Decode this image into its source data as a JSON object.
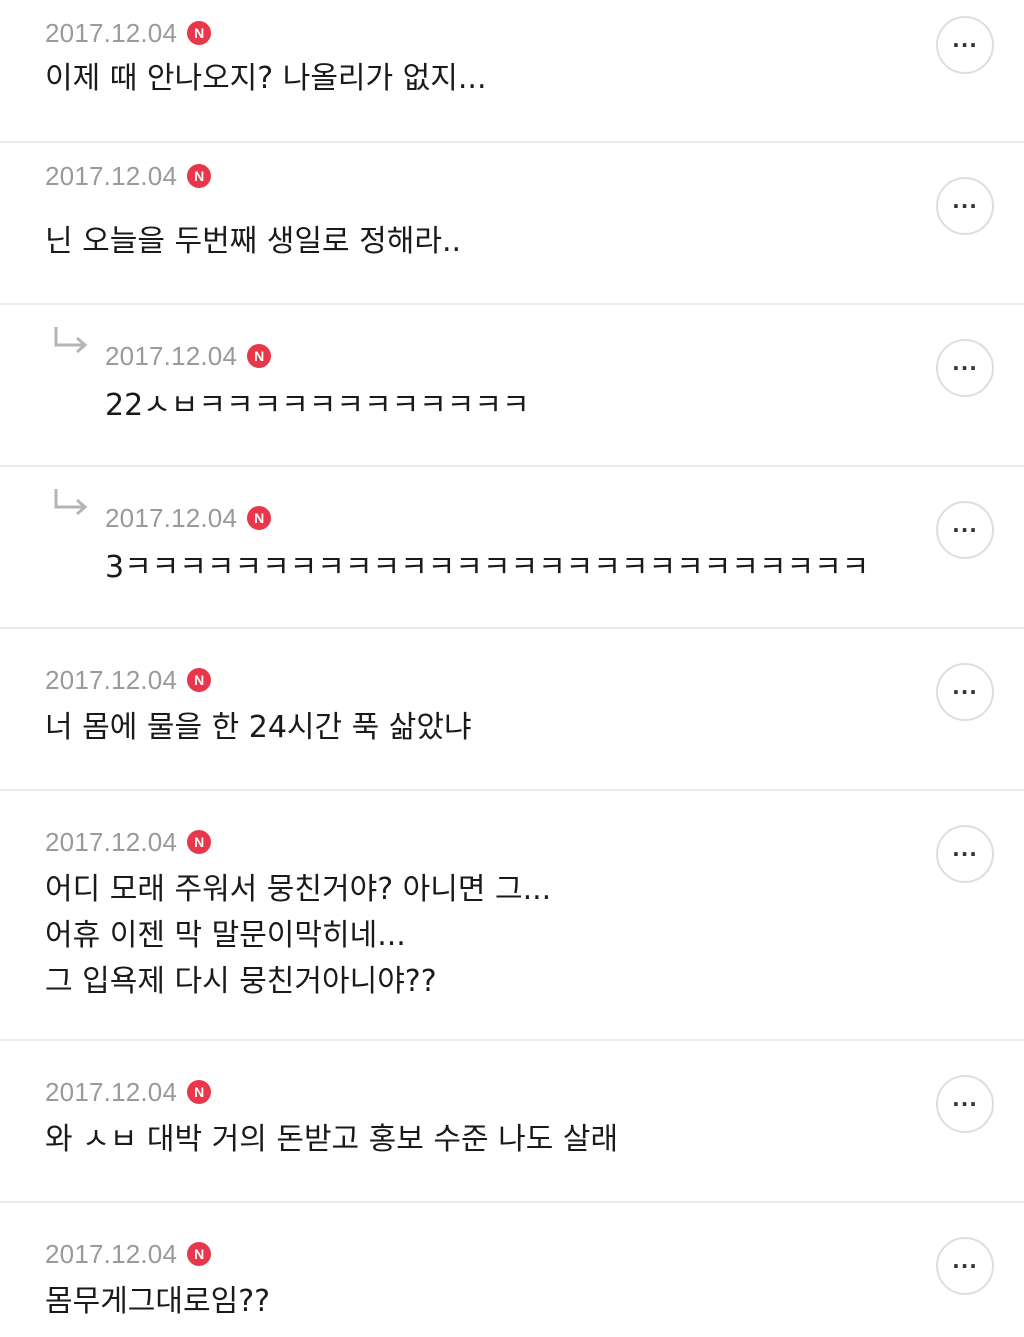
{
  "comments": [
    {
      "date": "2017.12.04",
      "badge": "N",
      "text": "이제 때 안나오지? 나올리가 없지...",
      "reply": false,
      "more_label": "..."
    },
    {
      "date": "2017.12.04",
      "badge": "N",
      "text": "닌 오늘을 두번째 생일로 정해라..",
      "reply": false,
      "more_label": "..."
    },
    {
      "date": "2017.12.04",
      "badge": "N",
      "text": "22ㅅㅂㅋㅋㅋㅋㅋㅋㅋㅋㅋㅋㅋㅋ",
      "reply": true,
      "more_label": "..."
    },
    {
      "date": "2017.12.04",
      "badge": "N",
      "text": "3ㅋㅋㅋㅋㅋㅋㅋㅋㅋㅋㅋㅋㅋㅋㅋㅋㅋㅋㅋㅋㅋㅋㅋㅋㅋㅋㅋ",
      "reply": true,
      "more_label": "..."
    },
    {
      "date": "2017.12.04",
      "badge": "N",
      "text": "너 몸에 물을 한 24시간 푹 삶았냐",
      "reply": false,
      "more_label": "..."
    },
    {
      "date": "2017.12.04",
      "badge": "N",
      "text": "어디 모래 주워서 뭉친거야? 아니면 그...\n어휴 이젠 막 말문이막히네...\n그 입욕제 다시 뭉친거아니야??",
      "reply": false,
      "more_label": "..."
    },
    {
      "date": "2017.12.04",
      "badge": "N",
      "text": "와 ㅅㅂ 대박 거의 돈받고 홍보 수준 나도 살래",
      "reply": false,
      "more_label": "..."
    },
    {
      "date": "2017.12.04",
      "badge": "N",
      "text": "몸무게그대로임??",
      "reply": false,
      "more_label": "..."
    }
  ]
}
